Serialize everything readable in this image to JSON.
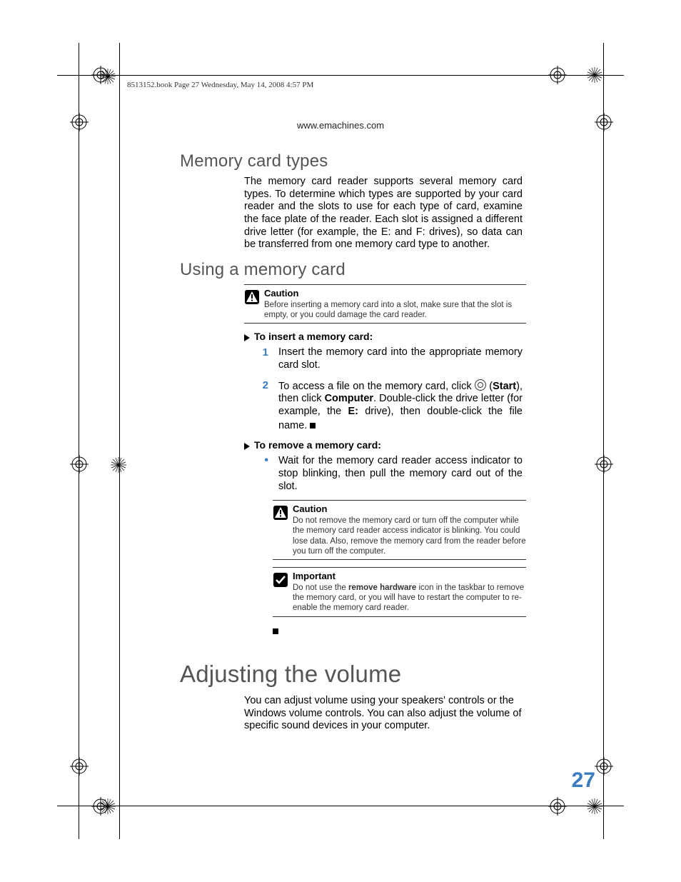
{
  "header": {
    "book_line": "8513152.book  Page 27  Wednesday, May 14, 2008  4:57 PM",
    "url": "www.emachines.com"
  },
  "section1": {
    "heading": "Memory card types",
    "body": "The memory card reader supports several memory card types. To determine which types are supported by your card reader and the slots to use for each type of card, examine the face plate of the reader. Each slot is assigned a different drive letter (for example, the E: and F: drives), so data can be transferred from one memory card type to another."
  },
  "section2": {
    "heading": "Using a memory card",
    "caution1": {
      "title": "Caution",
      "body": "Before inserting a memory card into a slot, make sure that the slot is empty, or you could damage the card reader."
    },
    "proc1_title": "To insert a memory card:",
    "steps_insert": [
      {
        "num": "1",
        "body": "Insert the memory card into the appropriate memory card slot."
      },
      {
        "num": "2",
        "start_label": "Start",
        "body_pre": "To access a file on the memory card, click ",
        "body_mid": "), then click ",
        "computer": "Computer",
        "body_post": ". Double-click the drive letter (for example, the ",
        "drive": "E:",
        "body_end": " drive), then double-click the file name."
      }
    ],
    "proc2_title": "To remove a memory card:",
    "steps_remove": [
      {
        "bullet": "•",
        "body": "Wait for the memory card reader access indicator to stop blinking, then pull the memory card out of the slot."
      }
    ],
    "caution2": {
      "title": "Caution",
      "body": "Do not remove the memory card or turn off the computer while the memory card reader access indicator is blinking. You could lose data. Also, remove the memory card from the reader before you turn off the computer."
    },
    "important": {
      "title": "Important",
      "body_pre": "Do not use the ",
      "bold": "remove hardware",
      "body_post": " icon in the taskbar to remove the memory card, or you will have to restart the computer to re-enable the memory card reader."
    }
  },
  "section3": {
    "heading": "Adjusting the volume",
    "body": "You can adjust volume using your speakers' controls or the Windows volume controls. You can also adjust the volume of specific sound devices in your computer."
  },
  "page_number": "27"
}
